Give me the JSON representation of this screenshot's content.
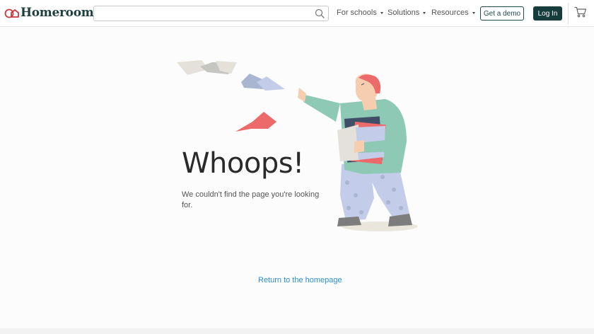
{
  "header": {
    "logo_text": "Homeroom",
    "search": {
      "placeholder": "",
      "value": ""
    },
    "nav": [
      {
        "label": "For schools"
      },
      {
        "label": "Solutions"
      },
      {
        "label": "Resources"
      }
    ],
    "demo_label": "Get a demo",
    "login_label": "Log In"
  },
  "main": {
    "title": "Whoops!",
    "message": "We couldn't find the page you're looking for.",
    "home_link": "Return to the homepage"
  },
  "colors": {
    "brand_dark": "#173c3c",
    "link": "#2e8fc9",
    "logo_red": "#c9393b"
  },
  "icons": [
    "logo-icon",
    "search-icon",
    "caret-down-icon",
    "cart-icon"
  ]
}
